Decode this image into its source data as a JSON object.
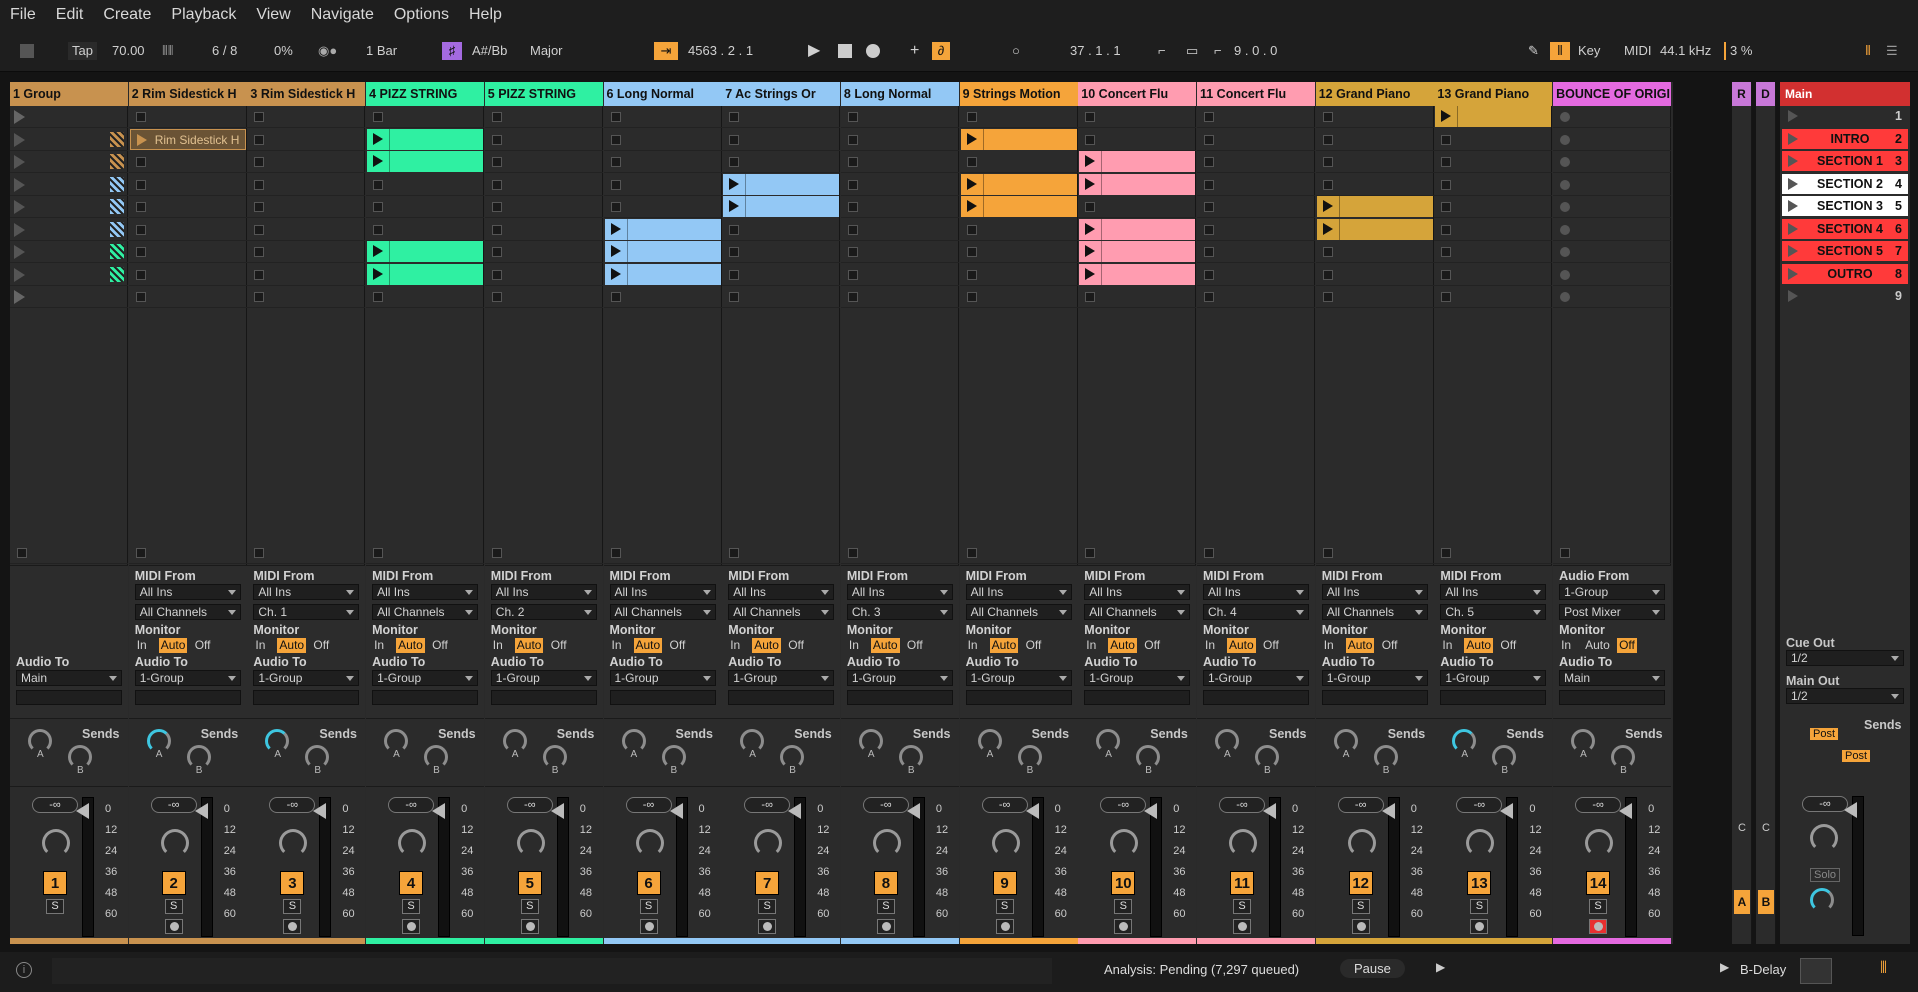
{
  "menu": [
    "File",
    "Edit",
    "Create",
    "Playback",
    "View",
    "Navigate",
    "Options",
    "Help"
  ],
  "transport": {
    "tap": "Tap",
    "tempo": "70.00",
    "meter_sig": "6 / 8",
    "swing": "0%",
    "quantize": "1 Bar",
    "key": "A#/Bb",
    "scale": "Major",
    "position": "4563 .  2 .  1",
    "loop_start": "37 .  1 .  1",
    "loop_length": "9 .  0 .  0",
    "key_label": "Key",
    "midi_label": "MIDI",
    "sample_rate": "44.1 kHz",
    "cpu": "3 %"
  },
  "tracks": [
    {
      "name": "1 Group",
      "color": "#c8924f",
      "num": "1",
      "audio_to": "Main",
      "is_group": true
    },
    {
      "name": "2 Rim Sidestick H",
      "color": "#c8924f",
      "num": "2",
      "midi_from": "All Ins",
      "channel": "All Channels",
      "audio_to": "1-Group"
    },
    {
      "name": "3 Rim Sidestick H",
      "color": "#c8924f",
      "num": "3",
      "midi_from": "All Ins",
      "channel": "Ch. 1",
      "audio_to": "1-Group"
    },
    {
      "name": "4 PIZZ STRING",
      "color": "#2ff0a2",
      "num": "4",
      "midi_from": "All Ins",
      "channel": "All Channels",
      "audio_to": "1-Group"
    },
    {
      "name": "5 PIZZ STRING",
      "color": "#2ff0a2",
      "num": "5",
      "midi_from": "All Ins",
      "channel": "Ch. 2",
      "audio_to": "1-Group"
    },
    {
      "name": "6 Long Normal",
      "color": "#93c8f5",
      "num": "6",
      "midi_from": "All Ins",
      "channel": "All Channels",
      "audio_to": "1-Group"
    },
    {
      "name": "7 Ac Strings Or",
      "color": "#93c8f5",
      "num": "7",
      "midi_from": "All Ins",
      "channel": "All Channels",
      "audio_to": "1-Group"
    },
    {
      "name": "8 Long Normal",
      "color": "#93c8f5",
      "num": "8",
      "midi_from": "All Ins",
      "channel": "Ch. 3",
      "audio_to": "1-Group"
    },
    {
      "name": "9 Strings Motion",
      "color": "#f5a43a",
      "num": "9",
      "midi_from": "All Ins",
      "channel": "All Channels",
      "audio_to": "1-Group"
    },
    {
      "name": "10 Concert Flu",
      "color": "#ff9cb0",
      "num": "10",
      "midi_from": "All Ins",
      "channel": "All Channels",
      "audio_to": "1-Group"
    },
    {
      "name": "11 Concert Flu",
      "color": "#ff9cb0",
      "num": "11",
      "midi_from": "All Ins",
      "channel": "Ch. 4",
      "audio_to": "1-Group"
    },
    {
      "name": "12 Grand Piano",
      "color": "#d5a43a",
      "num": "12",
      "midi_from": "All Ins",
      "channel": "All Channels",
      "audio_to": "1-Group"
    },
    {
      "name": "13 Grand Piano",
      "color": "#d5a43a",
      "num": "13",
      "midi_from": "All Ins",
      "channel": "Ch. 5",
      "audio_to": "1-Group"
    },
    {
      "name": "BOUNCE OF ORIGI",
      "color": "#e46ae0",
      "num": "14",
      "audio_from": "1-Group",
      "channel": "Post Mixer",
      "audio_to": "Main",
      "is_audio": true
    }
  ],
  "labels": {
    "midi_from": "MIDI From",
    "audio_from": "Audio From",
    "monitor": "Monitor",
    "audio_to": "Audio To",
    "sends": "Sends",
    "in": "In",
    "auto": "Auto",
    "off": "Off",
    "solo": "S",
    "vol": "-∞",
    "a": "A",
    "b": "B",
    "cue_out": "Cue Out",
    "main_out": "Main Out",
    "post": "Post",
    "solo_big": "Solo"
  },
  "meter_scale": [
    "0",
    "12",
    "24",
    "36",
    "48",
    "60"
  ],
  "clip_text": "Rim Sidestick H",
  "returns": {
    "r": "R",
    "d": "D",
    "c": "C"
  },
  "main": {
    "title": "Main",
    "cue": "1/2",
    "mainout": "1/2",
    "scenes": [
      {
        "name": "",
        "num": "1",
        "color": "#2b2b2b"
      },
      {
        "name": "INTRO",
        "num": "2",
        "color": "#ff3a3a"
      },
      {
        "name": "SECTION 1",
        "num": "3",
        "color": "#ff3a3a"
      },
      {
        "name": "SECTION 2",
        "num": "4",
        "color": "#ffffff"
      },
      {
        "name": "SECTION 3",
        "num": "5",
        "color": "#ffffff"
      },
      {
        "name": "SECTION 4",
        "num": "6",
        "color": "#ff3a3a"
      },
      {
        "name": "SECTION 5",
        "num": "7",
        "color": "#ff3a3a"
      },
      {
        "name": "OUTRO",
        "num": "8",
        "color": "#ff3a3a"
      },
      {
        "name": "",
        "num": "9",
        "color": "#2b2b2b"
      }
    ]
  },
  "status": {
    "analysis": "Analysis: Pending (7,297 queued)",
    "pause": "Pause",
    "device": "B-Delay"
  }
}
